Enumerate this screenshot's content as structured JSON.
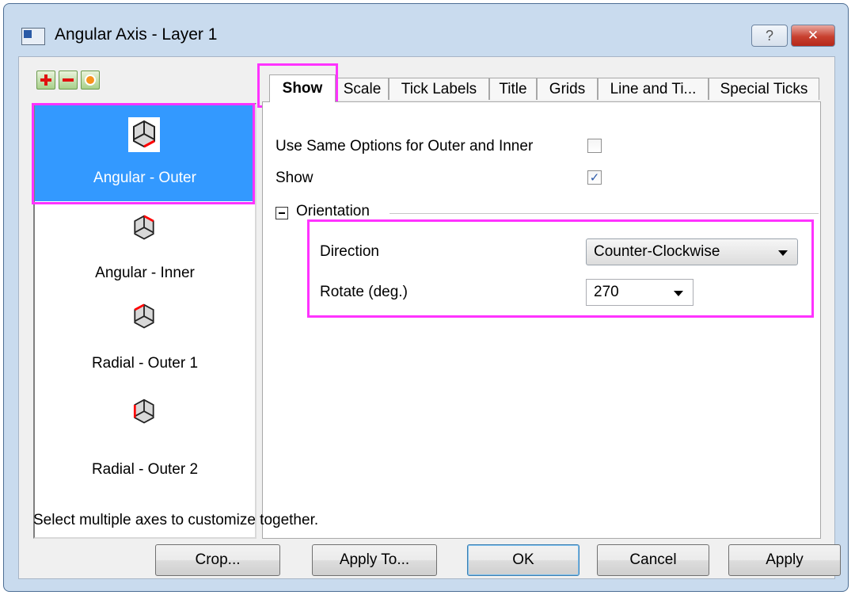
{
  "window": {
    "title": "Angular Axis - Layer 1",
    "help_label": "?",
    "close_label": "✕"
  },
  "toolbar": {
    "add_label": "+",
    "remove_label": "−",
    "reset_label": "●"
  },
  "axes_list": [
    {
      "label": "Angular - Outer",
      "selected": true
    },
    {
      "label": "Angular - Inner",
      "selected": false
    },
    {
      "label": "Radial - Outer 1",
      "selected": false
    },
    {
      "label": "Radial - Outer 2",
      "selected": false
    }
  ],
  "tabs": [
    {
      "label": "Show",
      "active": true
    },
    {
      "label": "Scale"
    },
    {
      "label": "Tick Labels"
    },
    {
      "label": "Title"
    },
    {
      "label": "Grids"
    },
    {
      "label": "Line and Ti..."
    },
    {
      "label": "Special Ticks"
    }
  ],
  "show_tab": {
    "same_options_label": "Use Same Options for Outer and Inner",
    "same_options_checked": false,
    "show_label": "Show",
    "show_checked": true,
    "checkmark": "✓",
    "orientation_group": "Orientation",
    "direction_label": "Direction",
    "direction_value": "Counter-Clockwise",
    "rotate_label": "Rotate (deg.)",
    "rotate_value": "270"
  },
  "status_text": "Select multiple axes to customize together.",
  "buttons": {
    "crop": "Crop...",
    "apply_to": "Apply To...",
    "ok": "OK",
    "cancel": "Cancel",
    "apply": "Apply"
  },
  "colors": {
    "highlight": "#ff33ff",
    "selection": "#3399ff",
    "axis_marker": "#ff0000"
  }
}
